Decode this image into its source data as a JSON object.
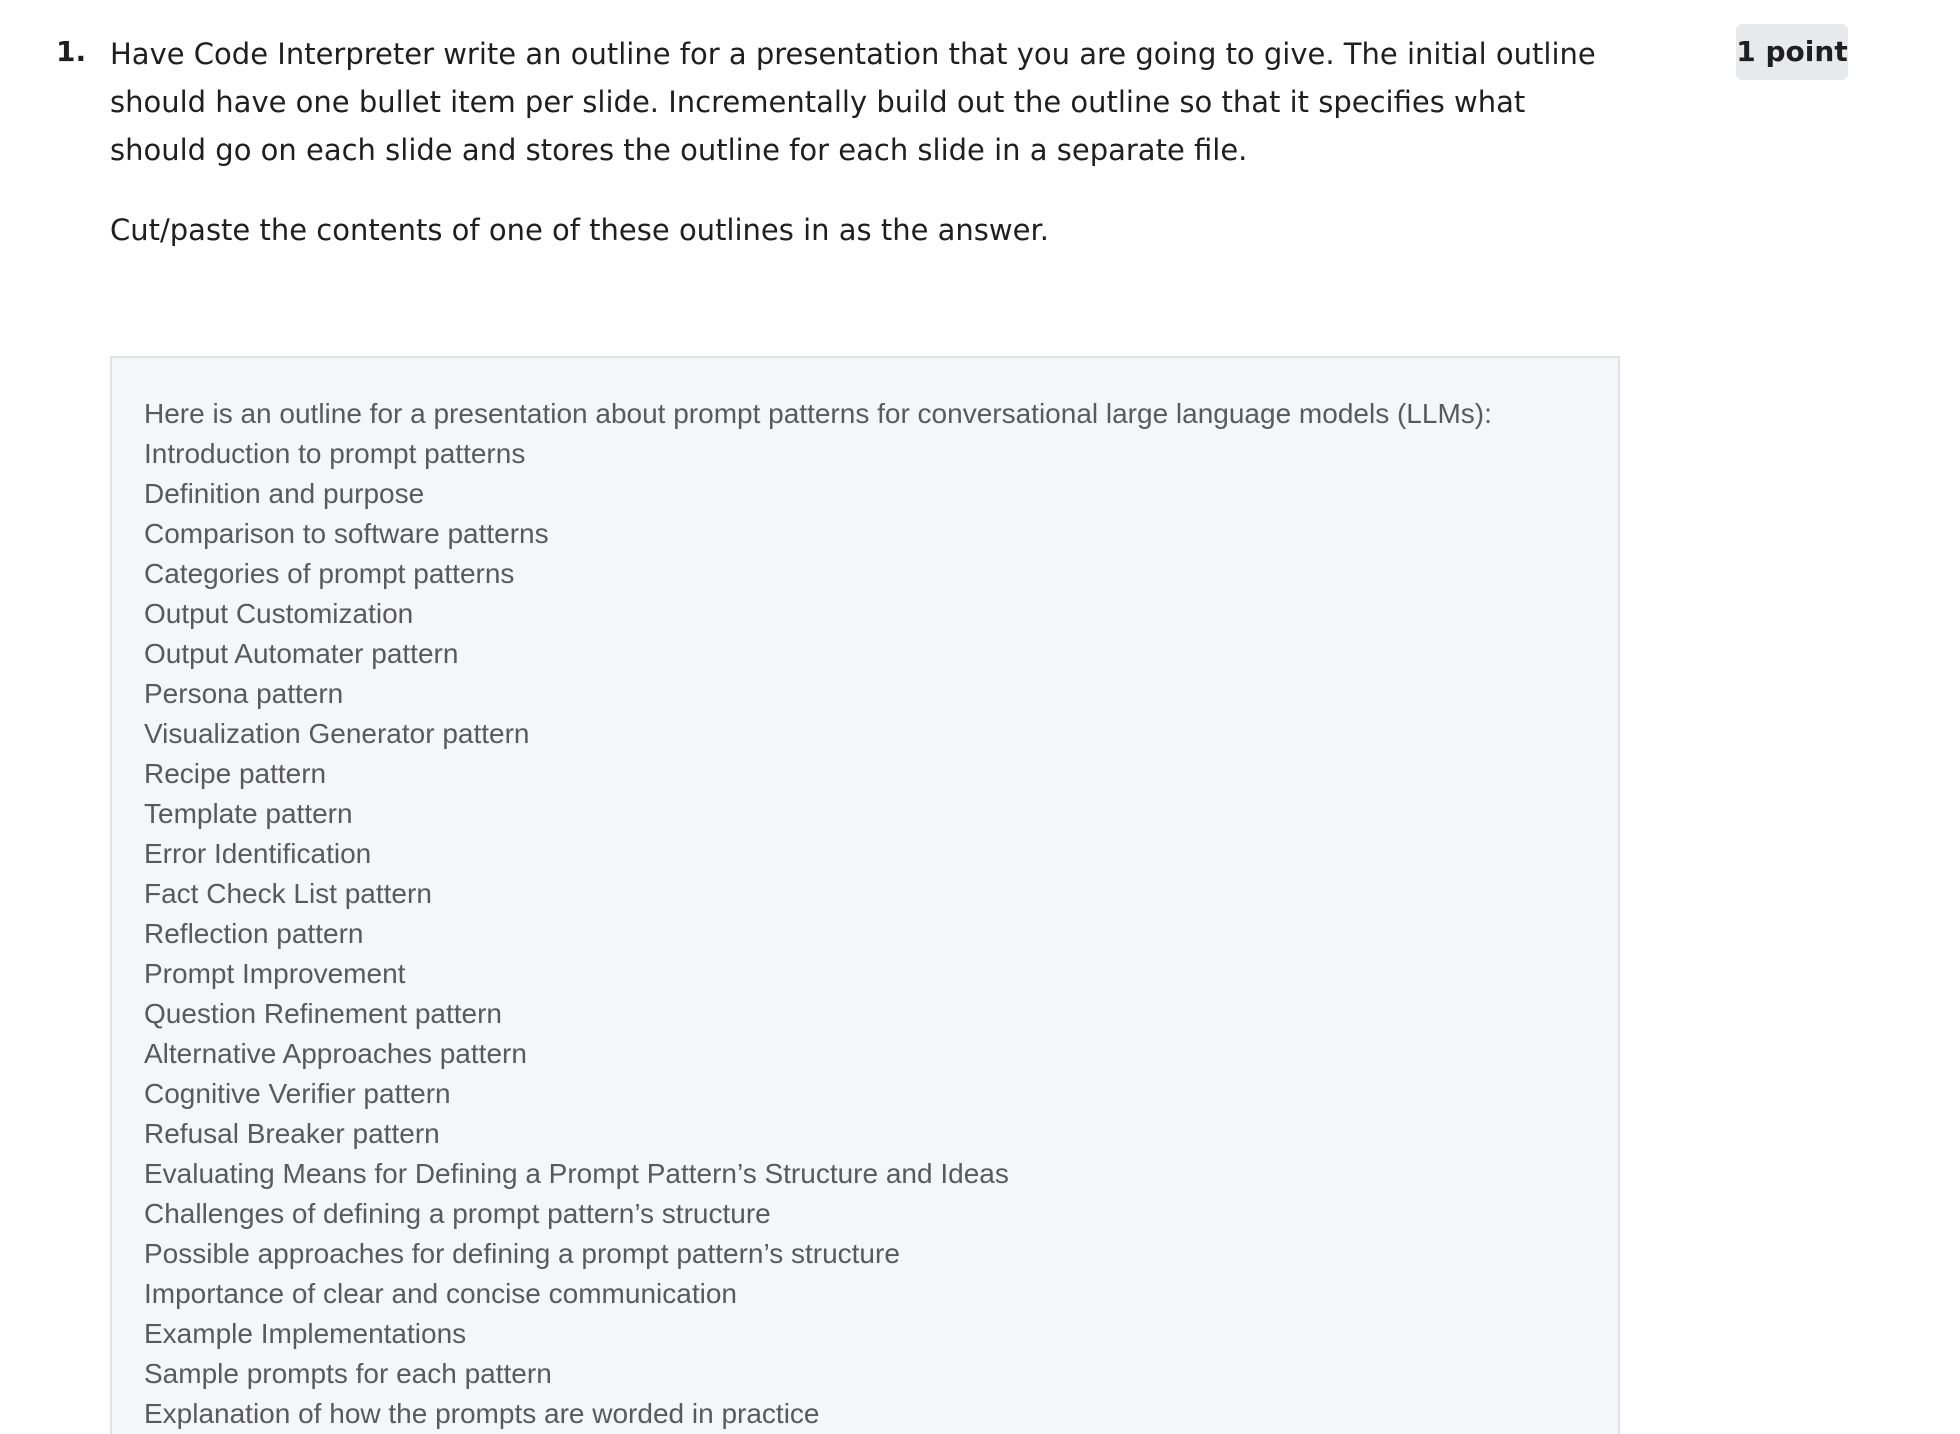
{
  "question": {
    "number": "1.",
    "prompt": "Have Code Interpreter write an outline for a presentation that you are going to give. The initial outline should have one bullet item per slide. Incrementally build out the outline so that it specifies what should go on each slide and stores the outline for each slide in a separate file.",
    "instruction": "Cut/paste the contents of one of these outlines in as the answer.",
    "points": "1 point"
  },
  "answer": {
    "lines": [
      "Here is an outline for a presentation about prompt patterns for conversational large language models (LLMs):",
      "Introduction to prompt patterns",
      "Definition and purpose",
      "Comparison to software patterns",
      "Categories of prompt patterns",
      "Output Customization",
      "Output Automater pattern",
      "Persona pattern",
      "Visualization Generator pattern",
      "Recipe pattern",
      "Template pattern",
      "Error Identification",
      "Fact Check List pattern",
      "Reflection pattern",
      "Prompt Improvement",
      "Question Refinement pattern",
      "Alternative Approaches pattern",
      "Cognitive Verifier pattern",
      "Refusal Breaker pattern",
      "Evaluating Means for Defining a Prompt Pattern’s Structure and Ideas",
      "Challenges of defining a prompt pattern’s structure",
      "Possible approaches for defining a prompt pattern’s structure",
      "Importance of clear and concise communication",
      "Example Implementations",
      "Sample prompts for each pattern",
      "Explanation of how the prompts are worded in practice"
    ]
  }
}
